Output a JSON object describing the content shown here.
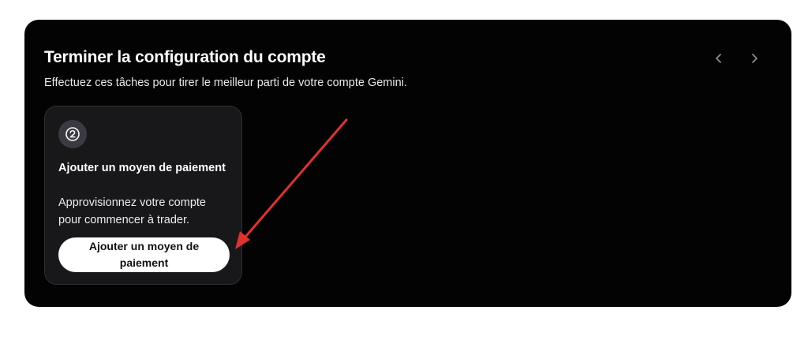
{
  "panel": {
    "title": "Terminer la configuration du compte",
    "subtitle": "Effectuez ces tâches pour tirer le meilleur parti de votre compte Gemini.",
    "nav": {
      "prev_icon": "chevron-left-icon",
      "next_icon": "chevron-right-icon"
    }
  },
  "task_card": {
    "step_icon": "circled-number-two-icon",
    "title": "Ajouter un moyen de paiement",
    "description": "Approvisionnez votre compte pour commencer à trader.",
    "button_label": "Ajouter un moyen de paiement"
  },
  "annotation": {
    "icon": "red-arrow-icon",
    "color": "#e03131"
  },
  "colors": {
    "page_background": "#ffffff",
    "panel_background": "#030304",
    "card_background": "#18181b",
    "button_background": "#ffffff",
    "arrow": "#e03131"
  }
}
